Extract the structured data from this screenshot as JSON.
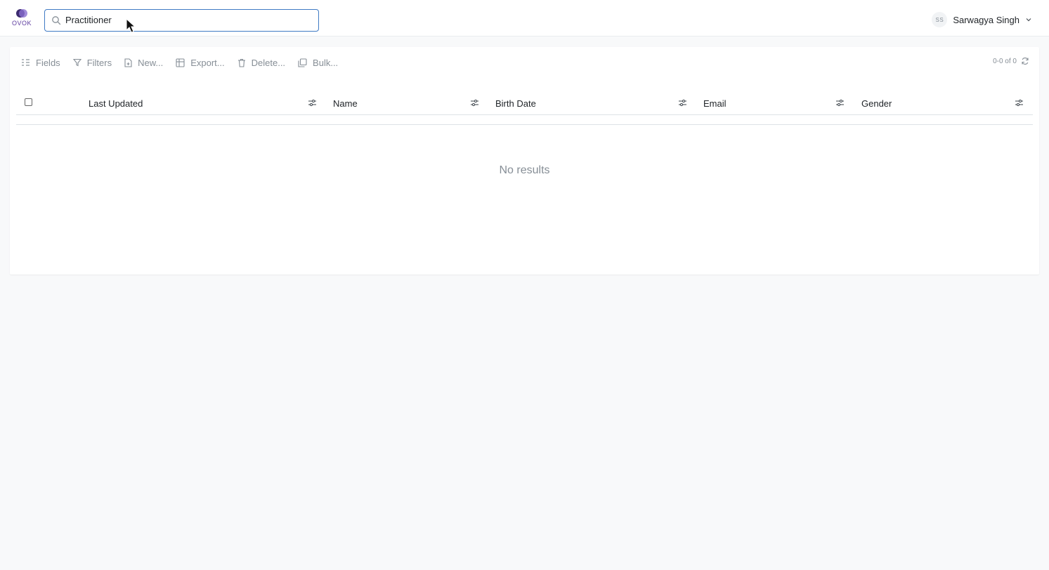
{
  "app": {
    "logo_text": "OVOK",
    "accent": "#3f7ac4",
    "brand": "#5c3b9e"
  },
  "search": {
    "value": "Practitioner",
    "icon": "search-icon"
  },
  "user": {
    "initials": "SS",
    "name": "Sarwagya Singh"
  },
  "toolbar": {
    "fields": "Fields",
    "filters": "Filters",
    "new": "New...",
    "export": "Export...",
    "delete": "Delete...",
    "bulk": "Bulk..."
  },
  "pager": {
    "text": "0-0 of 0"
  },
  "table": {
    "columns": [
      {
        "label": "Last Updated"
      },
      {
        "label": "Name"
      },
      {
        "label": "Birth Date"
      },
      {
        "label": "Email"
      },
      {
        "label": "Gender"
      }
    ],
    "empty_text": "No results"
  }
}
